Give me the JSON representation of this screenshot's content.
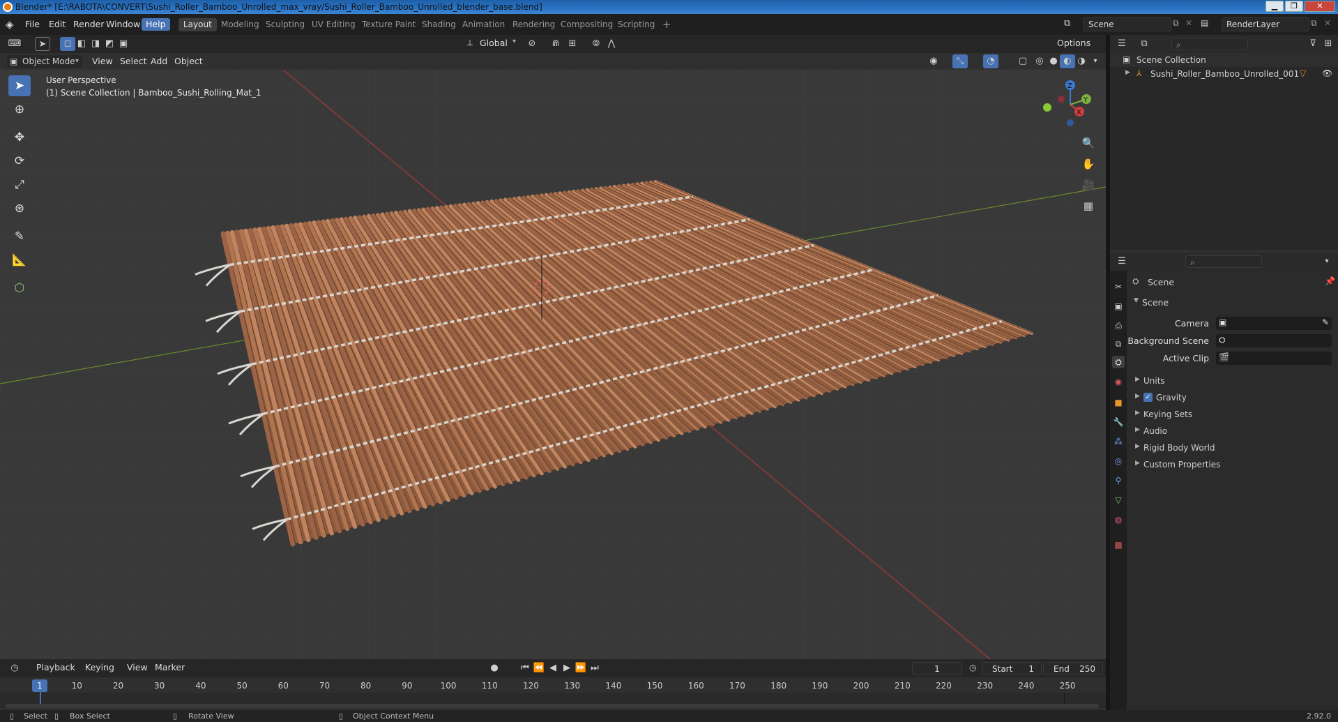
{
  "window": {
    "title": "Blender* [E:\\RABOTA\\CONVERT\\Sushi_Roller_Bamboo_Unrolled_max_vray/Sushi_Roller_Bamboo_Unrolled_blender_base.blend]",
    "minimize": "▁",
    "maximize": "❐",
    "close": "✕"
  },
  "menu": {
    "items": [
      "File",
      "Edit",
      "Render",
      "Window",
      "Help"
    ],
    "active": "Help"
  },
  "workspaces": {
    "items": [
      "Layout",
      "Modeling",
      "Sculpting",
      "UV Editing",
      "Texture Paint",
      "Shading",
      "Animation",
      "Rendering",
      "Compositing",
      "Scripting"
    ],
    "active": "Layout",
    "add": "+"
  },
  "scene_selector": {
    "value": "Scene"
  },
  "renderlayer_selector": {
    "value": "RenderLayer"
  },
  "tool_header": {
    "orientation": "Global",
    "options": "Options"
  },
  "viewport_header": {
    "mode": "Object Mode",
    "menus": [
      "View",
      "Select",
      "Add",
      "Object"
    ]
  },
  "viewport": {
    "perspective": "User Perspective",
    "collection_info": "(1) Scene Collection | Bamboo_Sushi_Rolling_Mat_1",
    "gizmo": {
      "z": "Z",
      "y": "Y",
      "x": "X"
    },
    "colors": {
      "x_axis": "#9b3a3a",
      "y_axis": "#6a8a2d",
      "bamboo": "#b07550",
      "rope": "#d8d6d0"
    }
  },
  "outliner": {
    "root": "Scene Collection",
    "item": "Sushi_Roller_Bamboo_Unrolled_001"
  },
  "properties": {
    "context": "Scene",
    "panel": "Scene",
    "fields": [
      {
        "label": "Camera",
        "value": ""
      },
      {
        "label": "Background Scene",
        "value": ""
      },
      {
        "label": "Active Clip",
        "value": ""
      }
    ],
    "sections": [
      "Units",
      "Gravity",
      "Keying Sets",
      "Audio",
      "Rigid Body World",
      "Custom Properties"
    ],
    "gravity_checked": true
  },
  "timeline": {
    "menus": [
      "Playback",
      "Keying",
      "View",
      "Marker"
    ],
    "current_frame": "1",
    "start_label": "Start",
    "start": "1",
    "end_label": "End",
    "end": "250",
    "ticks": [
      "10",
      "20",
      "30",
      "40",
      "50",
      "60",
      "70",
      "80",
      "90",
      "100",
      "110",
      "120",
      "130",
      "140",
      "150",
      "160",
      "170",
      "180",
      "190",
      "200",
      "210",
      "220",
      "230",
      "240",
      "250"
    ],
    "playhead": "1"
  },
  "status": {
    "select": "Select",
    "box_select": "Box Select",
    "rotate_view": "Rotate View",
    "context_menu": "Object Context Menu",
    "version": "2.92.0"
  }
}
